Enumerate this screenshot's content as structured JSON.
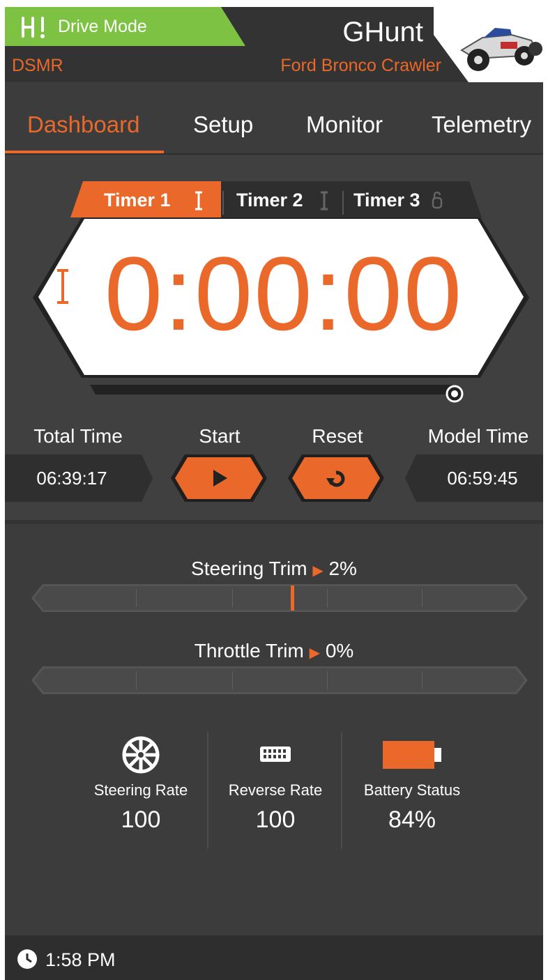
{
  "header": {
    "mode_label": "Drive Mode",
    "protocol": "DSMR",
    "model_name": "GHunt",
    "model_subtitle": "Ford Bronco Crawler",
    "accent_green": "#7dc242",
    "accent_orange": "#e9682a"
  },
  "tabs": [
    {
      "label": "Dashboard",
      "active": true
    },
    {
      "label": "Setup",
      "active": false
    },
    {
      "label": "Monitor",
      "active": false
    },
    {
      "label": "Telemetry",
      "active": false
    }
  ],
  "timer": {
    "tabs": [
      {
        "label": "Timer 1",
        "active": true,
        "icon": "stopwatch-icon"
      },
      {
        "label": "Timer 2",
        "active": false,
        "icon": "stopwatch-icon"
      },
      {
        "label": "Timer 3",
        "active": false,
        "icon": "lock-icon"
      }
    ],
    "display": "0:00:00",
    "total_time_label": "Total Time",
    "total_time": "06:39:17",
    "start_label": "Start",
    "reset_label": "Reset",
    "model_time_label": "Model Time",
    "model_time": "06:59:45"
  },
  "trims": {
    "steering": {
      "label": "Steering Trim",
      "value": "2%",
      "percent": 2
    },
    "throttle": {
      "label": "Throttle Trim",
      "value": "0%",
      "percent": 0
    }
  },
  "stats": {
    "steering_rate_label": "Steering Rate",
    "steering_rate": "100",
    "reverse_rate_label": "Reverse Rate",
    "reverse_rate": "100",
    "battery_label": "Battery Status",
    "battery": "84%"
  },
  "status": {
    "time": "1:58 PM"
  }
}
